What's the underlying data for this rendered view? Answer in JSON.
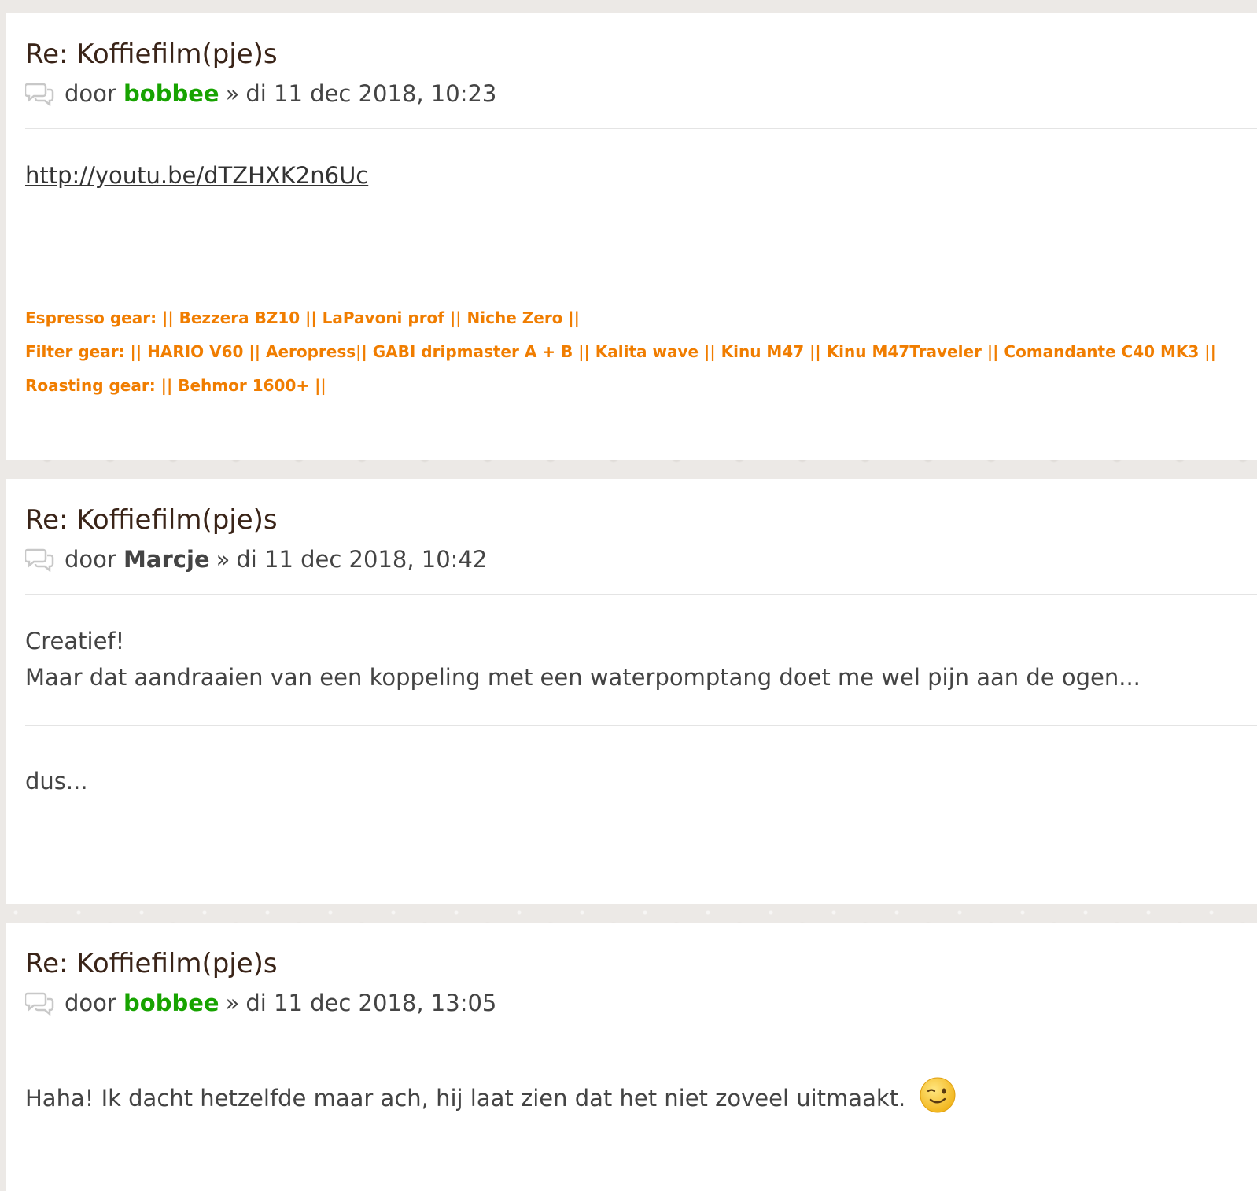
{
  "posts": [
    {
      "title": "Re: Koffiefilm(pje)s",
      "by": "door",
      "author": "bobbee",
      "sep": "»",
      "date": "di 11 dec 2018, 10:23",
      "link": "http://youtu.be/dTZHXK2n6Uc",
      "signature": [
        "Espresso gear: || Bezzera BZ10 || LaPavoni prof || Niche Zero ||",
        "Filter gear: || HARIO V60 || Aeropress|| GABI dripmaster A + B || Kalita wave || Kinu M47 || Kinu M47Traveler || Comandante C40 MK3 ||",
        "Roasting gear: || Behmor 1600+ ||"
      ]
    },
    {
      "title": "Re: Koffiefilm(pje)s",
      "by": "door",
      "author": "Marcje",
      "sep": "»",
      "date": "di 11 dec 2018, 10:42",
      "body": [
        "Creatief!",
        "Maar dat aandraaien van een koppeling met een waterpomptang doet me wel pijn aan de ogen..."
      ],
      "signature_text": "dus..."
    },
    {
      "title": "Re: Koffiefilm(pje)s",
      "by": "door",
      "author": "bobbee",
      "sep": "»",
      "date": "di 11 dec 2018, 13:05",
      "body": "Haha! Ik dacht hetzelfde maar ach, hij laat zien dat het niet zoveel uitmaakt.",
      "emoji": "wink-emoji"
    }
  ],
  "colors": {
    "author_green": "#17a300",
    "signature_orange": "#f07d00",
    "title_brown": "#3a2418"
  }
}
